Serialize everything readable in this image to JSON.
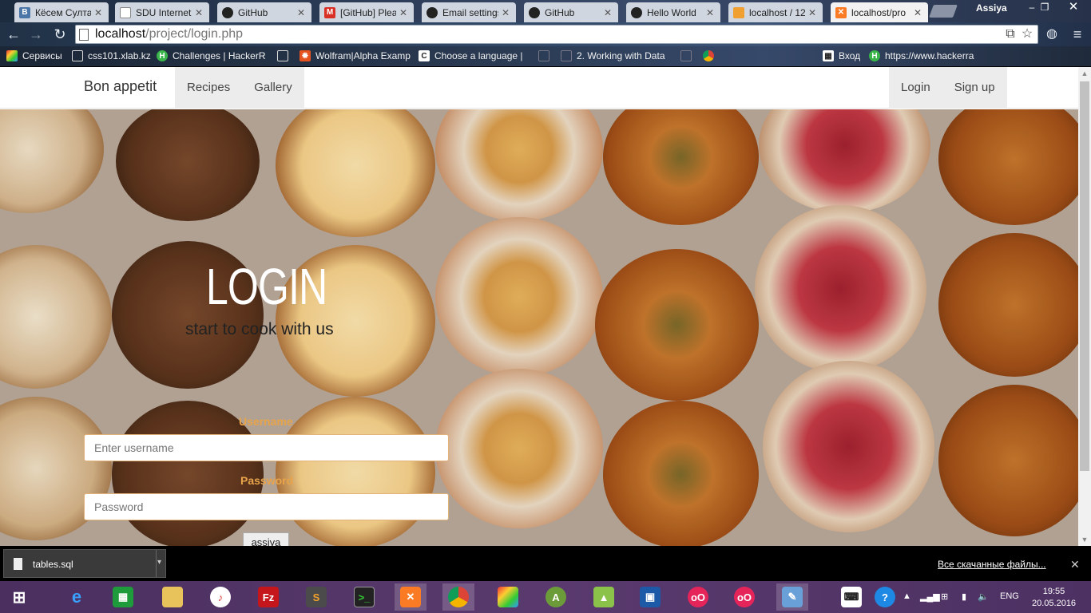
{
  "browser": {
    "tabs": [
      {
        "title": "Кёсем Султан",
        "icon": "vk-icon"
      },
      {
        "title": "SDU Internet",
        "icon": "document-icon"
      },
      {
        "title": "GitHub",
        "icon": "github-icon"
      },
      {
        "title": "[GitHub] Plea",
        "icon": "gmail-icon"
      },
      {
        "title": "Email settings",
        "icon": "github-icon"
      },
      {
        "title": "GitHub",
        "icon": "github-icon"
      },
      {
        "title": "Hello World",
        "icon": "github-icon"
      },
      {
        "title": "localhost / 12",
        "icon": "phpmyadmin-icon"
      },
      {
        "title": "localhost/pro",
        "icon": "xampp-icon"
      }
    ],
    "user": "Assiya",
    "url_host": "localhost",
    "url_path": "/project/login.php",
    "bookmarks": [
      {
        "label": "Сервисы",
        "icon": "apps-icon"
      },
      {
        "label": "css101.xlab.kz",
        "icon": "document-icon"
      },
      {
        "label": "Challenges | HackerR",
        "icon": "hackerrank-icon"
      },
      {
        "label": "",
        "icon": "document-icon"
      },
      {
        "label": "Wolfram|Alpha Examp",
        "icon": "wolfram-icon"
      },
      {
        "label": "Choose a language |",
        "icon": "codeacademy-icon"
      },
      {
        "label": "",
        "icon": "document-icon"
      },
      {
        "label": "2. Working with Data",
        "icon": "document-icon"
      },
      {
        "label": "",
        "icon": "document-icon"
      },
      {
        "label": "",
        "icon": "chrome-icon"
      },
      {
        "label": "Вход",
        "icon": "grid-icon"
      },
      {
        "label": "https://www.hackerra",
        "icon": "hackerrank-icon"
      }
    ]
  },
  "site": {
    "brand": "Bon appetit",
    "nav_left": [
      "Recipes",
      "Gallery"
    ],
    "nav_right": [
      "Login",
      "Sign up"
    ],
    "hero": {
      "title": "LOGIN",
      "subtitle": "start to cook with us"
    },
    "form": {
      "username_label": "Username",
      "username_placeholder": "Enter username",
      "password_label": "Password",
      "password_placeholder": "Password",
      "submit_label": "assiya"
    }
  },
  "downloads": {
    "file": "tables.sql",
    "show_all": "Все скачанные файлы..."
  },
  "taskbar": {
    "lang": "ENG",
    "time": "19:55",
    "date": "20.05.2016"
  }
}
